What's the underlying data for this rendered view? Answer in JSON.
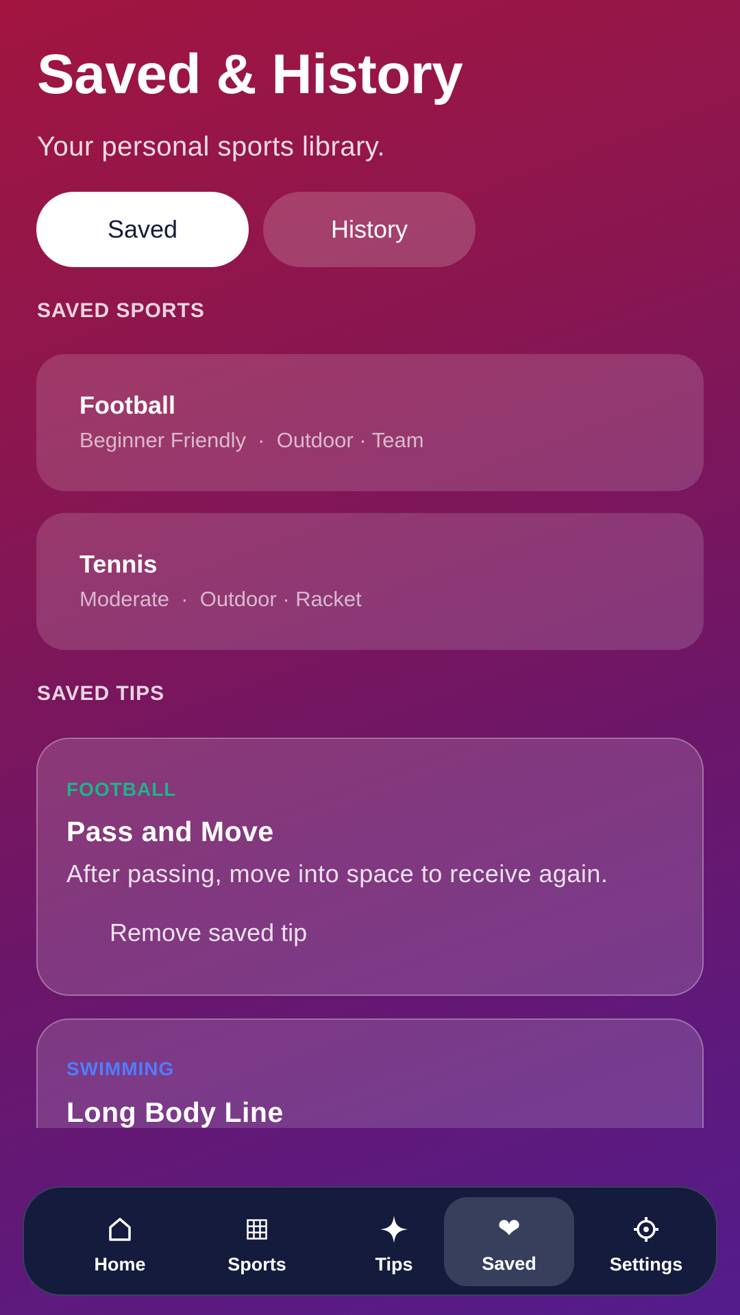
{
  "header": {
    "title": "Saved & History",
    "subtitle": "Your personal sports library."
  },
  "segments": {
    "saved_label": "Saved",
    "history_label": "History",
    "selected": "Saved"
  },
  "saved_sports": {
    "label": "SAVED SPORTS",
    "items": [
      {
        "name": "Football",
        "meta": "Beginner Friendly  ·  Outdoor · Team"
      },
      {
        "name": "Tennis",
        "meta": "Moderate  ·  Outdoor · Racket"
      }
    ]
  },
  "saved_tips": {
    "label": "SAVED TIPS",
    "items": [
      {
        "sport": "FOOTBALL",
        "sport_color": "#1fb38a",
        "title": "Pass and Move",
        "body": "After passing, move into space to receive again.",
        "remove_label": "Remove saved tip"
      },
      {
        "sport": "SWIMMING",
        "sport_color": "#4f7dff",
        "title": "Long Body Line"
      }
    ]
  },
  "nav": {
    "items": [
      {
        "label": "Home",
        "icon": "home-icon"
      },
      {
        "label": "Sports",
        "icon": "grid-icon"
      },
      {
        "label": "Tips",
        "icon": "sparkle-icon"
      },
      {
        "label": "Saved",
        "icon": "heart-icon"
      },
      {
        "label": "Settings",
        "icon": "gear-icon"
      }
    ],
    "active": "Saved"
  },
  "colors": {
    "background_start": "#a21540",
    "background_end": "#531c8c",
    "nav_background": "#141b3d",
    "heart": "#ff2d3a"
  }
}
